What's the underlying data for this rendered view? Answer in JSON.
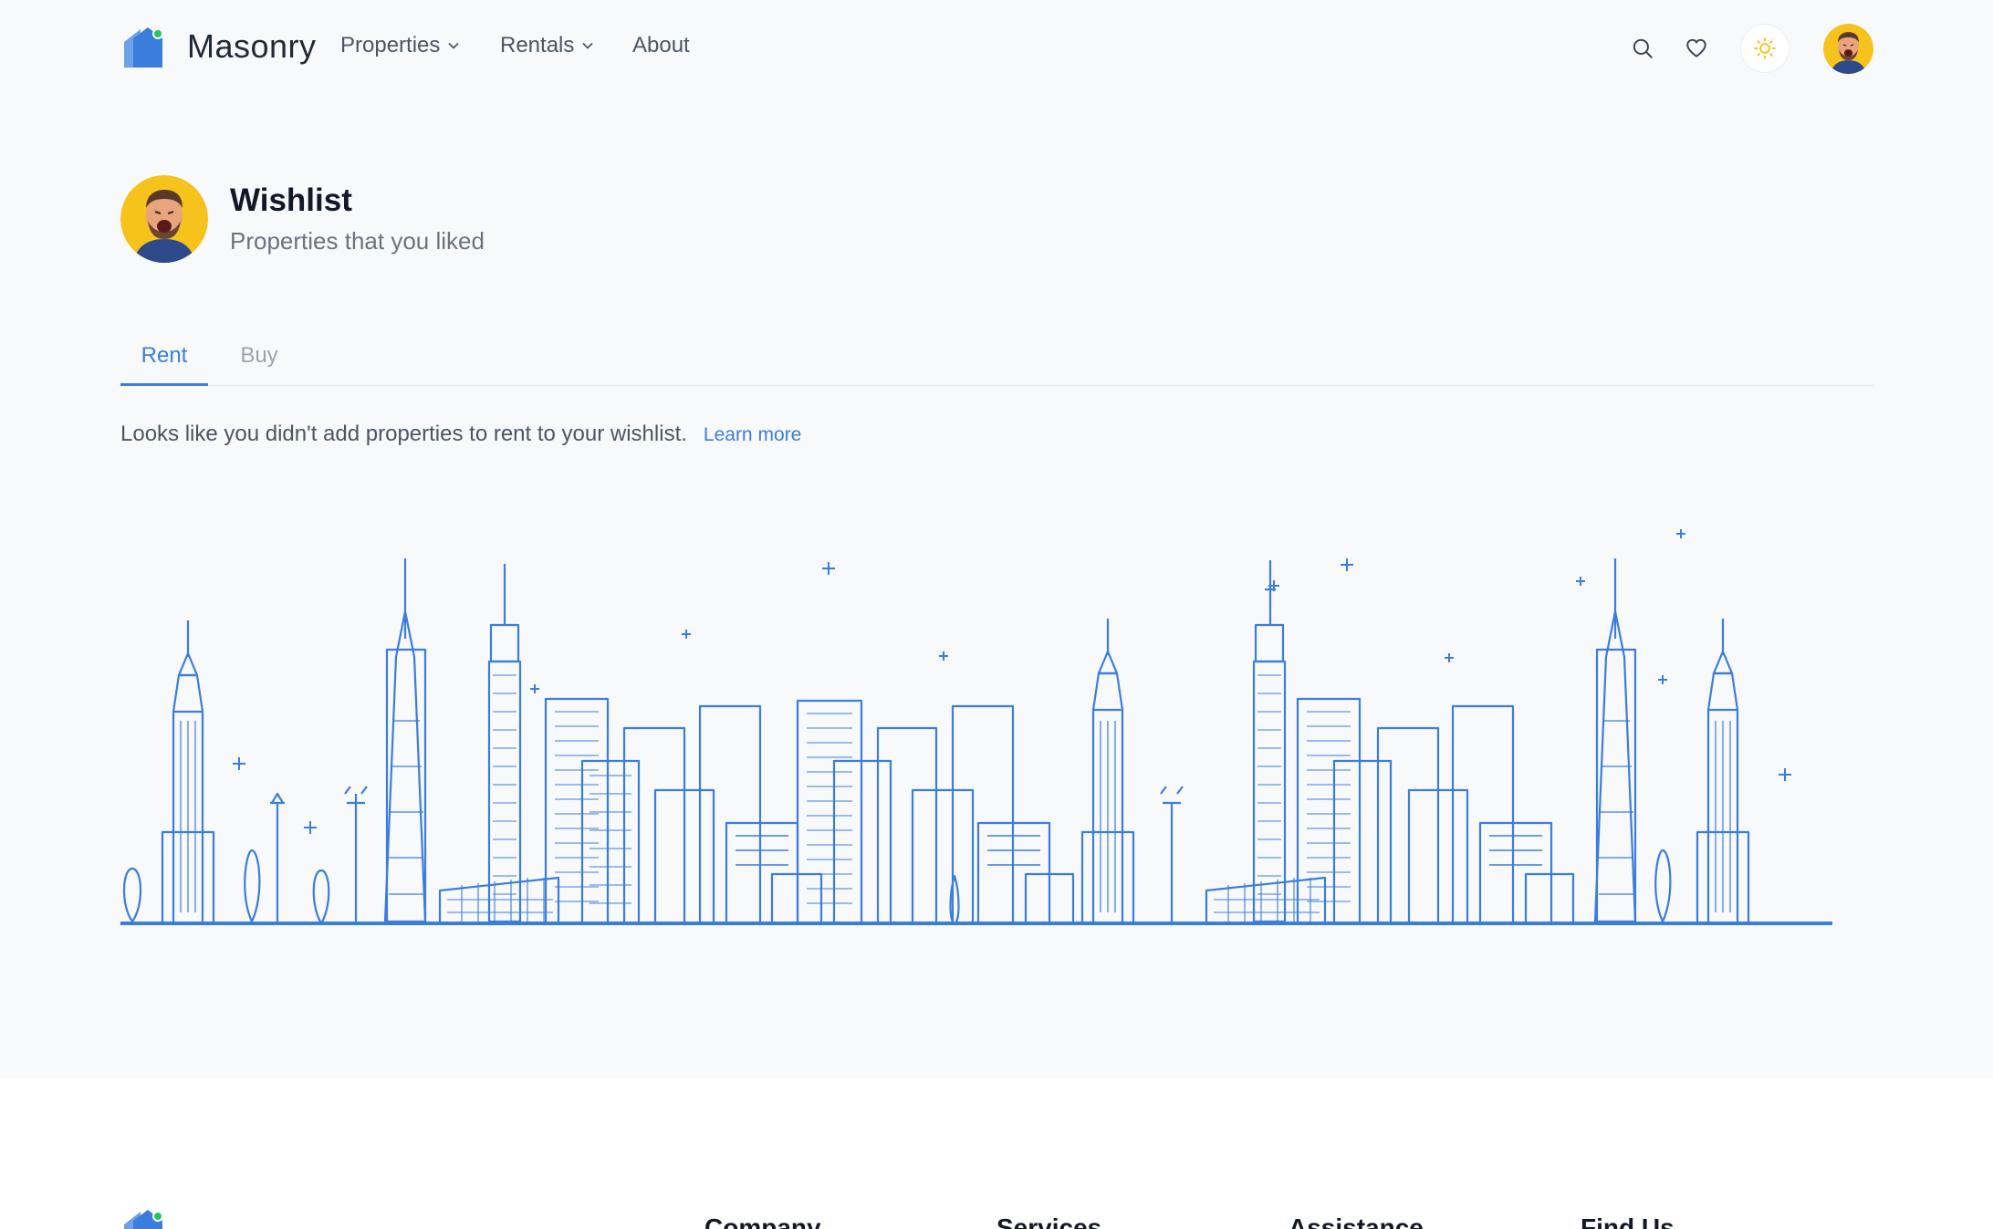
{
  "brand": {
    "name": "Masonry",
    "primary_color": "#3b7ddd",
    "accent_dot": "#22c55e"
  },
  "nav": {
    "properties_label": "Properties",
    "rentals_label": "Rentals",
    "about_label": "About"
  },
  "header_actions": {
    "search_icon": "search-icon",
    "wishlist_icon": "heart-icon",
    "theme_icon": "sun-icon",
    "theme_color": "#f5c518"
  },
  "profile": {
    "title": "Wishlist",
    "subtitle": "Properties that you liked"
  },
  "tabs": [
    {
      "label": "Rent",
      "active": true
    },
    {
      "label": "Buy",
      "active": false
    }
  ],
  "empty_state": {
    "message": "Looks like you didn't add properties to rent to your wishlist.",
    "link_label": "Learn more"
  },
  "footer": {
    "columns": [
      "Company",
      "Services",
      "Assistance",
      "Find Us"
    ]
  }
}
